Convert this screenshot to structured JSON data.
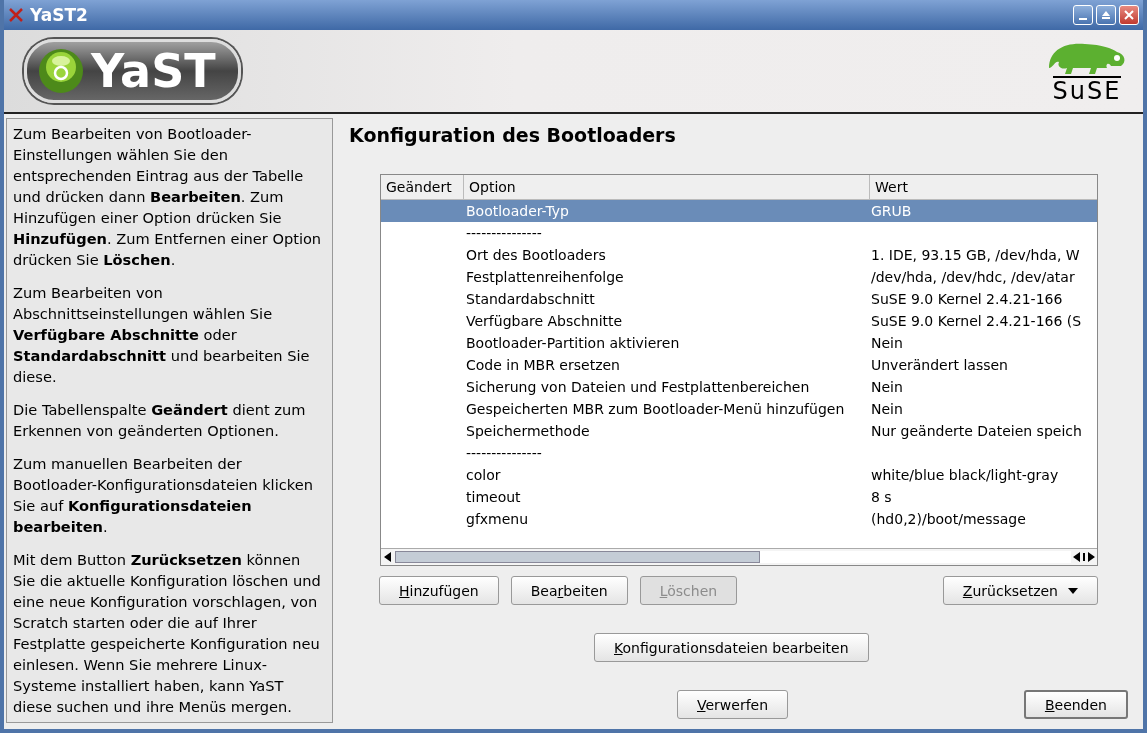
{
  "window": {
    "title": "YaST2"
  },
  "header": {
    "logo": "YaST",
    "brand": "SuSE"
  },
  "help": [
    "Zum Bearbeiten von Bootloader-Einstellungen wählen Sie den entsprechenden Eintrag aus der Tabelle und drücken dann **Bearbeiten**. Zum Hinzufügen einer Option drücken Sie **Hinzufügen**. Zum Entfernen einer Option drücken Sie **Löschen**.",
    "Zum Bearbeiten von Abschnittseinstellungen wählen Sie **Verfügbare Abschnitte** oder **Standardabschnitt** und bearbeiten Sie diese.",
    "Die Tabellenspalte **Geändert** dient zum Erkennen von geänderten Optionen.",
    "Zum manuellen Bearbeiten der Bootloader-Konfigurationsdateien klicken Sie auf **Konfigurationsdateien bearbeiten**.",
    "Mit dem Button **Zurücksetzen** können Sie die aktuelle Konfiguration löschen und eine neue Konfiguration vorschlagen, von Scratch starten oder die auf Ihrer Festplatte gespeicherte Konfiguration neu einlesen. Wenn Sie mehrere Linux-Systeme installiert haben, kann YaST diese suchen und ihre Menüs mergen."
  ],
  "page_title": "Konfiguration des Bootloaders",
  "table": {
    "columns": [
      "Geändert",
      "Option",
      "Wert"
    ],
    "rows": [
      {
        "option": "Bootloader-Typ",
        "value": "GRUB",
        "selected": true
      },
      {
        "option": "---------------",
        "selected": false
      },
      {
        "option": "Ort des Bootloaders",
        "value": "1. IDE, 93.15 GB, /dev/hda, W",
        "selected": false
      },
      {
        "option": "Festplattenreihenfolge",
        "value": "/dev/hda, /dev/hdc, /dev/atar",
        "selected": false
      },
      {
        "option": "Standardabschnitt",
        "value": "SuSE 9.0 Kernel 2.4.21-166",
        "selected": false
      },
      {
        "option": "Verfügbare Abschnitte",
        "value": "SuSE 9.0 Kernel 2.4.21-166 (S",
        "selected": false
      },
      {
        "option": "Bootloader-Partition aktivieren",
        "value": "Nein",
        "selected": false
      },
      {
        "option": "Code in MBR ersetzen",
        "value": "Unverändert lassen",
        "selected": false
      },
      {
        "option": "Sicherung von Dateien und Festplattenbereichen",
        "value": "Nein",
        "selected": false
      },
      {
        "option": "Gespeicherten MBR zum Bootloader-Menü hinzufügen",
        "value": "Nein",
        "selected": false
      },
      {
        "option": "Speichermethode",
        "value": "Nur geänderte Dateien speich",
        "selected": false
      },
      {
        "option": "---------------",
        "selected": false
      },
      {
        "option": "color",
        "value": "white/blue black/light-gray",
        "selected": false
      },
      {
        "option": "timeout",
        "value": "8 s",
        "selected": false
      },
      {
        "option": "gfxmenu",
        "value": "(hd0,2)/boot/message",
        "selected": false
      }
    ]
  },
  "table_buttons": [
    {
      "key": "H",
      "post": "inzufügen",
      "disabled": false
    },
    {
      "pre": "Bea",
      "key": "r",
      "post": "beiten",
      "disabled": false
    },
    {
      "key": "L",
      "post": "öschen",
      "disabled": true
    }
  ],
  "reset_button": {
    "key": "Z",
    "post": "urücksetzen"
  },
  "config_button": {
    "key": "K",
    "post": "onfigurationsdateien bearbeiten"
  },
  "discard_button": {
    "key": "V",
    "post": "erwerfen"
  },
  "finish_button": {
    "key": "B",
    "post": "eenden"
  }
}
